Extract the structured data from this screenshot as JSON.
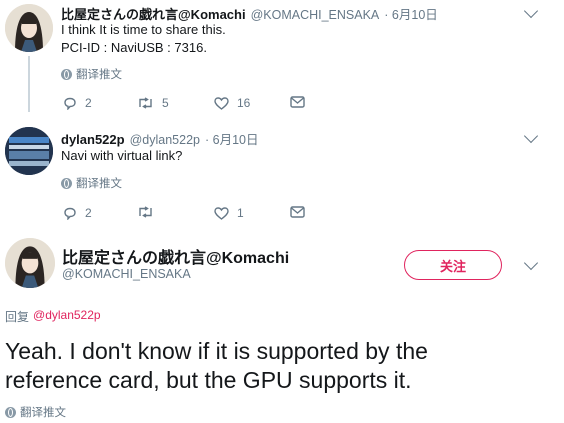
{
  "tweet1": {
    "name": "比屋定さんの戯れ言@Komachi",
    "handle": "@KOMACHI_ENSAKA",
    "date": "· 6月10日",
    "lines": [
      "I think It is time to share this.",
      "PCI-ID : NaviUSB : 7316."
    ],
    "translate": "翻译推文",
    "replies": "2",
    "retweets": "5",
    "likes": "16"
  },
  "tweet2": {
    "name": "dylan522p",
    "handle": "@dylan522p",
    "date": "· 6月10日",
    "text": "Navi with virtual link?",
    "translate": "翻译推文",
    "replies": "2",
    "retweets": "",
    "likes": "1"
  },
  "main": {
    "name": "比屋定さんの戯れ言@Komachi",
    "handle": "@KOMACHI_ENSAKA",
    "follow": "关注",
    "reply_prefix": "回复",
    "reply_to": "@dylan522p",
    "lines": [
      "Yeah. I don't know if it is supported by the",
      "reference card, but the GPU supports it."
    ],
    "translate": "翻译推文"
  },
  "colors": {
    "accent": "#1da1f2",
    "follow": "#e0245e",
    "muted": "#657786"
  },
  "icons": [
    "reply-icon",
    "retweet-icon",
    "like-icon",
    "message-icon",
    "globe-icon",
    "chevron-down-icon"
  ]
}
